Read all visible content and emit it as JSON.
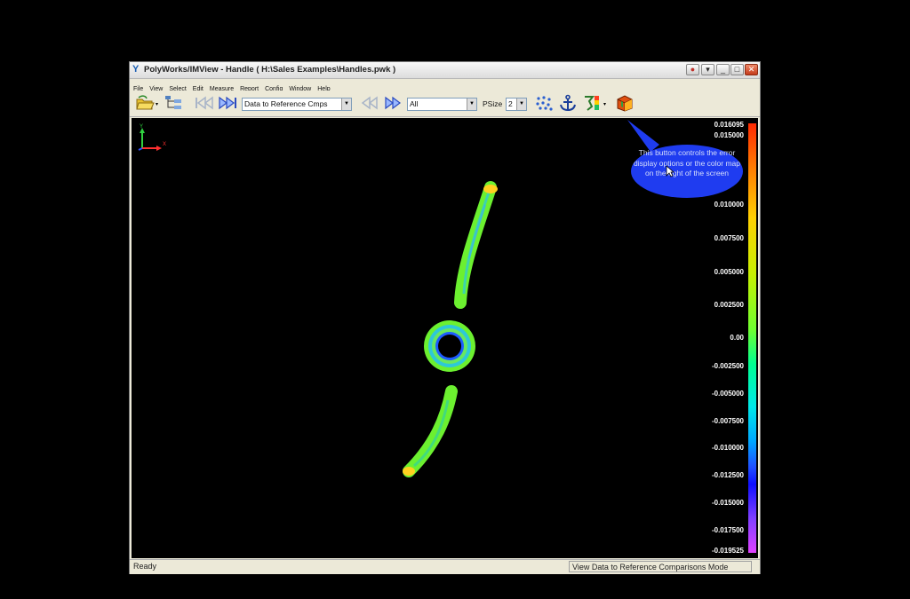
{
  "window": {
    "title": "PolyWorks/IMView - Handle ( H:\\Sales Examples\\Handles.pwk )"
  },
  "menu": [
    "File",
    "View",
    "Select",
    "Edit",
    "Measure",
    "Report",
    "Config",
    "Window",
    "Help"
  ],
  "toolbar": {
    "comparison_combo": "Data to Reference Cmps",
    "filter_combo": "All",
    "psize_label": "PSize",
    "psize_value": "2"
  },
  "color_scale": {
    "labels": [
      "0.016095",
      "0.015000",
      "0.010000",
      "0.007500",
      "0.005000",
      "0.002500",
      "0.00",
      "-0.002500",
      "-0.005000",
      "-0.007500",
      "-0.010000",
      "-0.012500",
      "-0.015000",
      "-0.017500",
      "-0.019525"
    ]
  },
  "callout": {
    "text": "This button controls the error display options or the color map on the right of the screen"
  },
  "axes": {
    "y_label": "Y",
    "x_label": "X"
  },
  "status": {
    "left": "Ready",
    "right": "View Data to Reference Comparisons Mode"
  }
}
